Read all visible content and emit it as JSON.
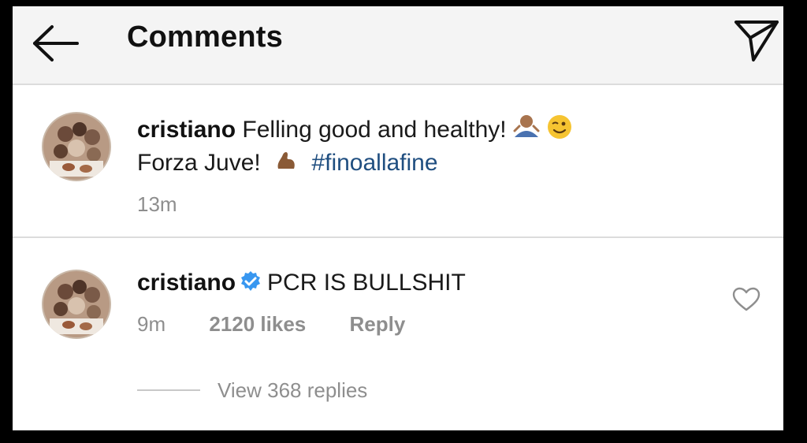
{
  "header": {
    "title": "Comments",
    "back_icon": "back-arrow-icon",
    "send_icon": "send-icon"
  },
  "post": {
    "username": "cristiano",
    "caption_line1": "Felling good and healthy!",
    "caption_line2": "Forza Juve!",
    "hashtag": "#finoallafine",
    "time": "13m",
    "emojis": [
      "shrug-emoji",
      "wink-emoji",
      "flexed-biceps-emoji"
    ]
  },
  "comment": {
    "username": "cristiano",
    "verified": true,
    "text": "PCR IS BULLSHIT",
    "time": "9m",
    "likes": "2120 likes",
    "reply_label": "Reply",
    "view_replies": "View 368 replies"
  },
  "colors": {
    "hashtag": "#1f4e80",
    "verified_badge": "#3897f0",
    "meta_text": "#8e8e8e",
    "border": "#000000"
  }
}
